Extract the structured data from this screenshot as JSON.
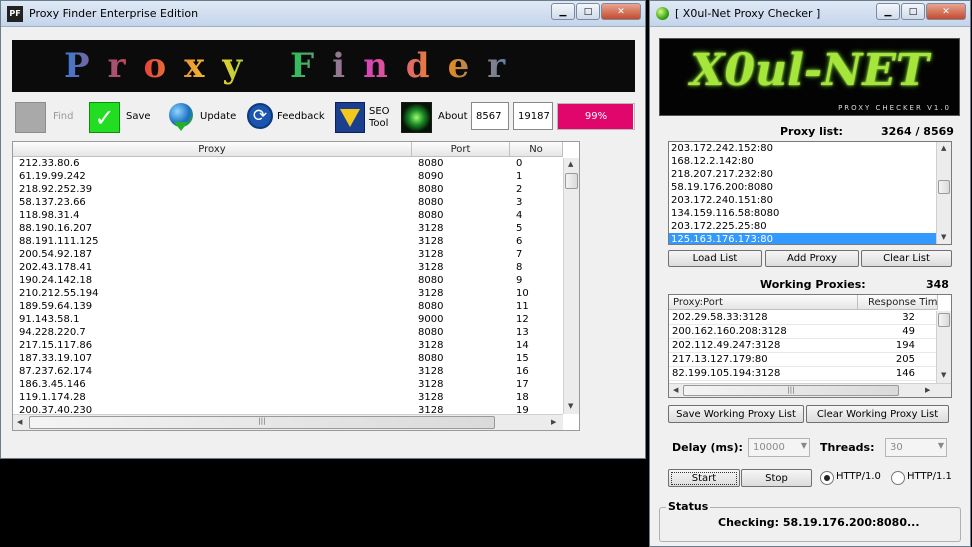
{
  "pf": {
    "title": "Proxy Finder Enterprise Edition",
    "app_icon_text": "PF",
    "banner_text": "Proxy Finder",
    "toolbar": {
      "find": "Find",
      "save": "Save",
      "update": "Update",
      "feedback": "Feedback",
      "seo_line1": "SEO",
      "seo_line2": "Tool",
      "about": "About",
      "counter_a": "8567",
      "counter_b": "19187",
      "progress_text": "99%",
      "progress_fraction": 0.99
    },
    "columns": [
      "Proxy",
      "Port",
      "No"
    ],
    "rows": [
      [
        "212.33.80.6",
        "8080",
        "0"
      ],
      [
        "61.19.99.242",
        "8090",
        "1"
      ],
      [
        "218.92.252.39",
        "8080",
        "2"
      ],
      [
        "58.137.23.66",
        "8080",
        "3"
      ],
      [
        "118.98.31.4",
        "8080",
        "4"
      ],
      [
        "88.190.16.207",
        "3128",
        "5"
      ],
      [
        "88.191.111.125",
        "3128",
        "6"
      ],
      [
        "200.54.92.187",
        "3128",
        "7"
      ],
      [
        "202.43.178.41",
        "3128",
        "8"
      ],
      [
        "190.24.142.18",
        "8080",
        "9"
      ],
      [
        "210.212.55.194",
        "3128",
        "10"
      ],
      [
        "189.59.64.139",
        "8080",
        "11"
      ],
      [
        "91.143.58.1",
        "9000",
        "12"
      ],
      [
        "94.228.220.7",
        "8080",
        "13"
      ],
      [
        "217.15.117.86",
        "3128",
        "14"
      ],
      [
        "187.33.19.107",
        "8080",
        "15"
      ],
      [
        "87.237.62.174",
        "3128",
        "16"
      ],
      [
        "186.3.45.146",
        "3128",
        "17"
      ],
      [
        "119.1.174.28",
        "3128",
        "18"
      ],
      [
        "200.37.40.230",
        "3128",
        "19"
      ]
    ]
  },
  "pc": {
    "title": "[ X0ul-Net Proxy Checker ]",
    "logo_text": "X0ul-NET",
    "logo_sub": "PROXY CHECKER V1.0",
    "proxy_list_label": "Proxy list:",
    "proxy_list_count": "3264 / 8569",
    "proxy_list": [
      "203.172.242.152:80",
      "168.12.2.142:80",
      "218.207.217.232:80",
      "58.19.176.200:8080",
      "203.172.240.151:80",
      "134.159.116.58:8080",
      "203.172.225.25:80",
      "125.163.176.173:80"
    ],
    "selected_index": 7,
    "load_list": "Load List",
    "add_proxy": "Add Proxy",
    "clear_list": "Clear List",
    "working_label": "Working Proxies:",
    "working_count": "348",
    "working_columns": [
      "Proxy:Port",
      "Response Tim"
    ],
    "working_rows": [
      [
        "202.29.58.33:3128",
        "32"
      ],
      [
        "200.162.160.208:3128",
        "49"
      ],
      [
        "202.112.49.247:3128",
        "194"
      ],
      [
        "217.13.127.179:80",
        "205"
      ],
      [
        "82.199.105.194:3128",
        "146"
      ]
    ],
    "save_working": "Save Working Proxy List",
    "clear_working": "Clear Working Proxy List",
    "delay_label": "Delay (ms):",
    "delay_value": "10000",
    "threads_label": "Threads:",
    "threads_value": "30",
    "start": "Start",
    "stop": "Stop",
    "http10": "HTTP/1.0",
    "http11": "HTTP/1.1",
    "status_label": "Status",
    "status_text": "Checking: 58.19.176.200:8080..."
  },
  "colors": {
    "selection": "#3399ff",
    "progress": "#e0066b",
    "save_green": "#22dd22",
    "logo_green": "#a6e63a"
  }
}
